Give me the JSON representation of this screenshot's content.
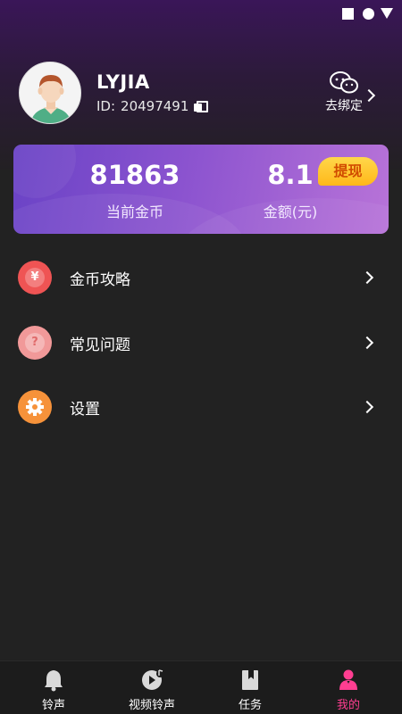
{
  "profile": {
    "username": "LYJIA",
    "id_label": "ID:",
    "id_value": "20497491",
    "bind_label": "去绑定",
    "bind_icon": "wechat-icon"
  },
  "coins": {
    "current_coins_value": "81863",
    "current_coins_label": "当前金币",
    "amount_value": "8.1",
    "amount_label": "金额(元)",
    "withdraw_label": "提现"
  },
  "menu": {
    "items": [
      {
        "label": "金币攻略",
        "icon": "yuan-icon",
        "color": "#ef5454"
      },
      {
        "label": "常见问题",
        "icon": "question-icon",
        "color": "#f19999"
      },
      {
        "label": "设置",
        "icon": "gear-icon",
        "color": "#f6923a"
      }
    ]
  },
  "tabbar": {
    "tabs": [
      {
        "label": "铃声",
        "icon": "bell-icon",
        "active": false
      },
      {
        "label": "视频铃声",
        "icon": "video-ringtone-icon",
        "active": false
      },
      {
        "label": "任务",
        "icon": "task-icon",
        "active": false
      },
      {
        "label": "我的",
        "icon": "person-icon",
        "active": true
      }
    ],
    "active_color": "#ff3e91"
  },
  "colors": {
    "background": "#222222",
    "card_gradient_start": "#6a43c6",
    "card_gradient_end": "#b873d8",
    "withdraw_button": "#ffc52a"
  }
}
